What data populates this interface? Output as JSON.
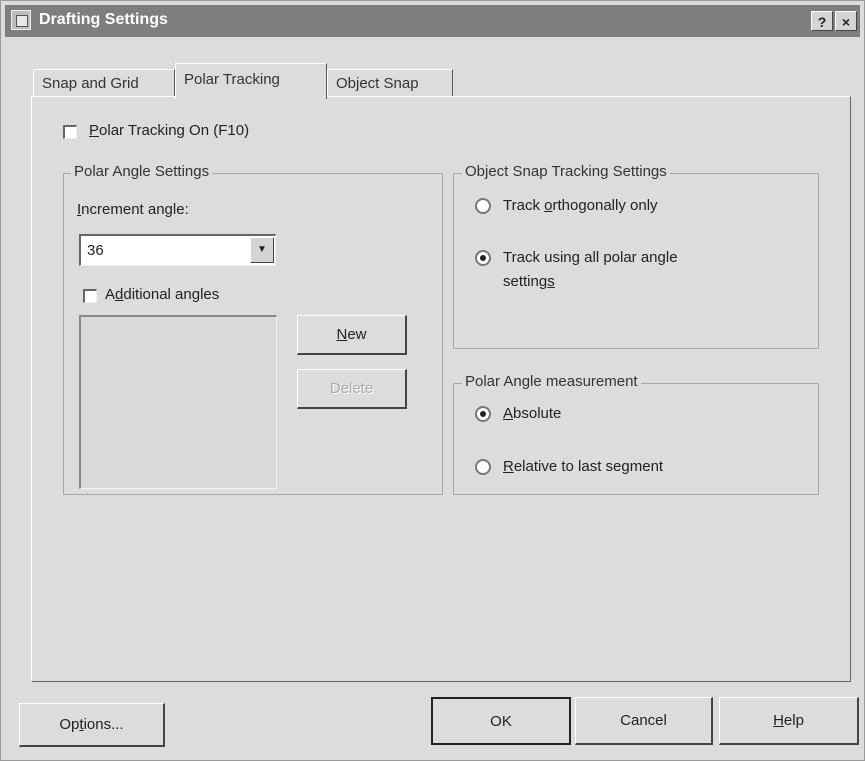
{
  "window": {
    "title": "Drafting Settings",
    "help_glyph": "?",
    "close_glyph": "×"
  },
  "tabs": [
    {
      "label": "Snap and Grid",
      "active": false
    },
    {
      "label": "Polar Tracking",
      "active": true
    },
    {
      "label": "Object Snap",
      "active": false
    }
  ],
  "polar_tracking_on": {
    "label": "Polar Tracking On (F10)",
    "checked": false
  },
  "polar_angle_settings": {
    "title": "Polar Angle Settings",
    "increment_label": "Increment angle:",
    "increment_value": "36",
    "additional_angles": {
      "label": "Additional angles",
      "checked": false
    },
    "new_label": "New",
    "delete_label": "Delete"
  },
  "object_snap_tracking": {
    "title": "Object Snap Tracking Settings",
    "options": [
      {
        "label": "Track orthogonally only",
        "selected": false
      },
      {
        "label_line1": "Track using all polar angle",
        "label_line2": "settings",
        "selected": true
      }
    ]
  },
  "polar_angle_measurement": {
    "title": "Polar Angle measurement",
    "options": [
      {
        "label": "Absolute",
        "selected": true
      },
      {
        "label": "Relative to last segment",
        "selected": false
      }
    ]
  },
  "footer": {
    "options_label": "Options...",
    "ok_label": "OK",
    "cancel_label": "Cancel",
    "help_label": "Help"
  }
}
